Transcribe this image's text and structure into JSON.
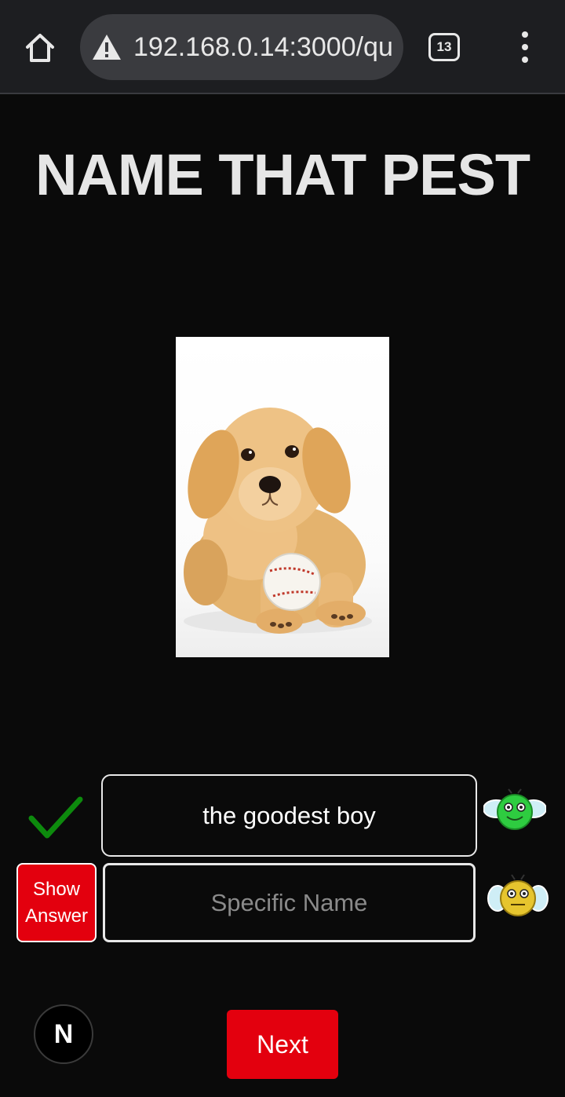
{
  "browser": {
    "url": "192.168.0.14:3000/qu",
    "tab_count": "13",
    "icons": [
      "home-icon",
      "warning-icon",
      "tab-switcher-icon",
      "more-vert-icon"
    ]
  },
  "page": {
    "title": "NAME THAT PEST"
  },
  "quiz": {
    "common_name_answer": "the goodest boy",
    "common_name_correct": true,
    "specific_name_placeholder": "Specific Name",
    "specific_name_value": "",
    "show_answer_label_line1": "Show",
    "show_answer_label_line2": "Answer",
    "next_label": "Next"
  },
  "footer": {
    "badge_letter": "N"
  },
  "colors": {
    "background": "#0a0a0a",
    "accent_red": "#e3000e",
    "check_green": "#0d8a0d",
    "bug_green": "#2ecc40",
    "bug_yellow": "#e6c52e"
  }
}
